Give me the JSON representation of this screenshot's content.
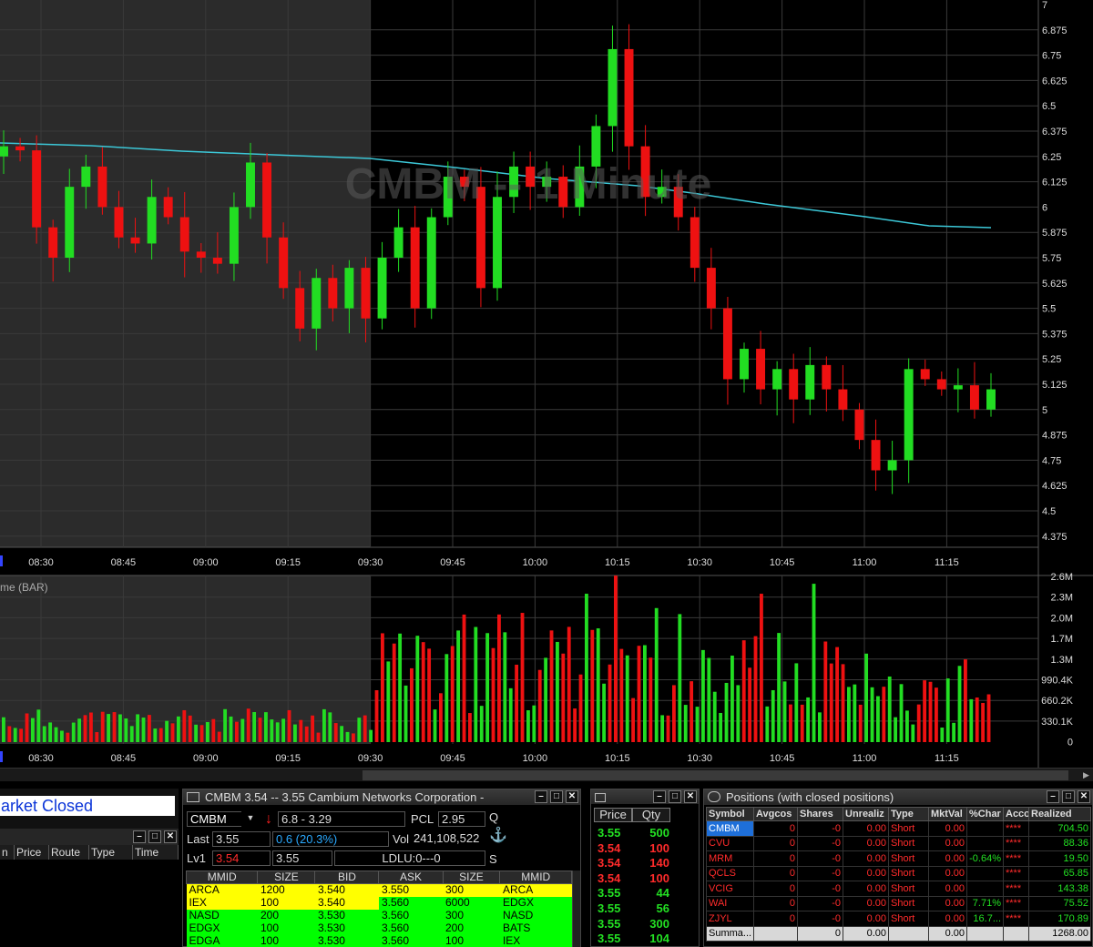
{
  "chart": {
    "watermark": "CMBM -- 1 Minute",
    "volume_label": "me (BAR)",
    "price_axis": [
      "7",
      "6.875",
      "6.75",
      "6.625",
      "6.5",
      "6.375",
      "6.25",
      "6.125",
      "6",
      "5.875",
      "5.75",
      "5.625",
      "5.5",
      "5.375",
      "5.25",
      "5.125",
      "5",
      "4.875",
      "4.75",
      "4.625",
      "4.5",
      "4.375"
    ],
    "volume_axis": [
      "2.6M",
      "2.3M",
      "2.0M",
      "1.7M",
      "1.3M",
      "990.4K",
      "660.2K",
      "330.1K",
      "0"
    ],
    "time_axis": [
      "08:30",
      "08:45",
      "09:00",
      "09:15",
      "09:30",
      "09:45",
      "10:00",
      "10:15",
      "10:30",
      "10:45",
      "11:00",
      "11:15"
    ],
    "colors": {
      "up": "#22dd22",
      "down": "#ee1111",
      "ma": "#3cc8d8",
      "premarket_bg": "#2b2b2b",
      "grid": "#3a3a3a"
    },
    "candles_close_approx": [
      6.3,
      6.28,
      5.9,
      5.75,
      6.1,
      6.2,
      6.0,
      5.85,
      5.82,
      6.05,
      5.95,
      5.78,
      5.75,
      5.72,
      6.0,
      6.22,
      5.85,
      5.6,
      5.4,
      5.65,
      5.5,
      5.7,
      5.45,
      5.75,
      5.9,
      5.5,
      5.95,
      6.15,
      6.1,
      5.6,
      6.05,
      6.2,
      6.1,
      6.15,
      6.0,
      6.2,
      6.4,
      6.78,
      6.3,
      6.05,
      6.1,
      5.95,
      5.7,
      5.5,
      5.15,
      5.3,
      5.1,
      5.2,
      5.05,
      5.22,
      5.1,
      5.0,
      4.85,
      4.7,
      4.75,
      5.2,
      5.15,
      5.1,
      5.12,
      5.0,
      5.1
    ]
  },
  "left_panel": {
    "market_status": "arket Closed",
    "order_columns": [
      "n",
      "Price",
      "Route",
      "Type",
      "Time"
    ]
  },
  "level2": {
    "title": "CMBM     3.54 -- 3.55     Cambium Networks Corporation -",
    "symbol": "CMBM",
    "range": "6.8 - 3.29",
    "pcl_label": "PCL",
    "pcl": "2.95",
    "q_label": "Q",
    "last_label": "Last",
    "last": "3.55",
    "change": "0.6  (20.3%)",
    "vol_label": "Vol",
    "vol": "241,108,522",
    "lv1_label": "Lv1",
    "lv1_bid": "3.54",
    "lv1_ask": "3.55",
    "ldlu": "LDLU:0---0",
    "s_label": "S",
    "columns": [
      "MMID",
      "SIZE",
      "BID",
      "ASK",
      "SIZE",
      "MMID"
    ],
    "rows": [
      {
        "bid_mmid": "ARCA",
        "bid_size": "1200",
        "bid": "3.540",
        "ask": "3.550",
        "ask_size": "300",
        "ask_mmid": "ARCA",
        "bid_color": "#ffff00",
        "ask_color": "#ffff00"
      },
      {
        "bid_mmid": "IEX",
        "bid_size": "100",
        "bid": "3.540",
        "ask": "3.560",
        "ask_size": "6000",
        "ask_mmid": "EDGX",
        "bid_color": "#ffff00",
        "ask_color": "#00ff00"
      },
      {
        "bid_mmid": "NASD",
        "bid_size": "200",
        "bid": "3.530",
        "ask": "3.560",
        "ask_size": "300",
        "ask_mmid": "NASD",
        "bid_color": "#00ff00",
        "ask_color": "#00ff00"
      },
      {
        "bid_mmid": "EDGX",
        "bid_size": "100",
        "bid": "3.530",
        "ask": "3.560",
        "ask_size": "200",
        "ask_mmid": "BATS",
        "bid_color": "#00ff00",
        "ask_color": "#00ff00"
      },
      {
        "bid_mmid": "EDGA",
        "bid_size": "100",
        "bid": "3.530",
        "ask": "3.560",
        "ask_size": "100",
        "ask_mmid": "IEX",
        "bid_color": "#00ff00",
        "ask_color": "#00ff00"
      }
    ]
  },
  "time_sales": {
    "columns": [
      "Price",
      "Qty"
    ],
    "rows": [
      {
        "price": "3.55",
        "qty": "500",
        "color": "#23e023"
      },
      {
        "price": "3.54",
        "qty": "100",
        "color": "#ff2b2b"
      },
      {
        "price": "3.54",
        "qty": "140",
        "color": "#ff2b2b"
      },
      {
        "price": "3.54",
        "qty": "100",
        "color": "#ff2b2b"
      },
      {
        "price": "3.55",
        "qty": "44",
        "color": "#23e023"
      },
      {
        "price": "3.55",
        "qty": "56",
        "color": "#23e023"
      },
      {
        "price": "3.55",
        "qty": "300",
        "color": "#23e023"
      },
      {
        "price": "3.55",
        "qty": "104",
        "color": "#23e023"
      }
    ]
  },
  "positions": {
    "title": "Positions (with closed positions)",
    "columns": [
      "Symbol",
      "Avgcos",
      "Shares",
      "Unrealiz",
      "Type",
      "MktVal",
      "%Char",
      "Acco",
      "Realized"
    ],
    "rows": [
      {
        "symbol": "CMBM",
        "avgcost": "0",
        "shares": "-0",
        "unrealized": "0.00",
        "type": "Short",
        "mktval": "0.00",
        "pct": "",
        "acct": "****",
        "realized": "704.50",
        "selected": true
      },
      {
        "symbol": "CVU",
        "avgcost": "0",
        "shares": "-0",
        "unrealized": "0.00",
        "type": "Short",
        "mktval": "0.00",
        "pct": "",
        "acct": "****",
        "realized": "88.36"
      },
      {
        "symbol": "MRM",
        "avgcost": "0",
        "shares": "-0",
        "unrealized": "0.00",
        "type": "Short",
        "mktval": "0.00",
        "pct": "-0.64%",
        "acct": "****",
        "realized": "19.50"
      },
      {
        "symbol": "QCLS",
        "avgcost": "0",
        "shares": "-0",
        "unrealized": "0.00",
        "type": "Short",
        "mktval": "0.00",
        "pct": "",
        "acct": "****",
        "realized": "65.85"
      },
      {
        "symbol": "VCIG",
        "avgcost": "0",
        "shares": "-0",
        "unrealized": "0.00",
        "type": "Short",
        "mktval": "0.00",
        "pct": "",
        "acct": "****",
        "realized": "143.38"
      },
      {
        "symbol": "WAI",
        "avgcost": "0",
        "shares": "-0",
        "unrealized": "0.00",
        "type": "Short",
        "mktval": "0.00",
        "pct": "7.71%",
        "acct": "****",
        "realized": "75.52"
      },
      {
        "symbol": "ZJYL",
        "avgcost": "0",
        "shares": "-0",
        "unrealized": "0.00",
        "type": "Short",
        "mktval": "0.00",
        "pct": "16.7...",
        "acct": "****",
        "realized": "170.89"
      }
    ],
    "summary": {
      "label": "Summa...",
      "shares": "0",
      "unrealized": "0.00",
      "mktval": "0.00",
      "realized": "1268.00"
    }
  }
}
